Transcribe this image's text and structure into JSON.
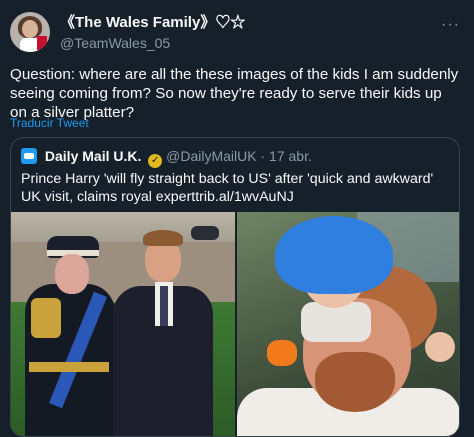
{
  "tweet": {
    "author": {
      "display_name": "《The Wales Family》♡☆",
      "handle": "@TeamWales_05"
    },
    "more_icon": "more-icon",
    "text": "Question: where are all the these images of the kids I am suddenly seeing coming from? So now they're ready to serve their kids up on a silver platter?",
    "translate_label": "Traducir Tweet"
  },
  "quoted_tweet": {
    "name": "Daily Mail U.K.",
    "verified_icon": "verified-badge-icon",
    "handle": "@DailyMailUK",
    "separator": "·",
    "date": "17 abr.",
    "text": "Prince Harry 'will fly straight back to US' after 'quick and awkward' UK visit, claims royal experttrib.al/1wvAuNJ"
  },
  "colors": {
    "background": "#15202b",
    "text": "#f7f9f9",
    "muted": "#8b98a5",
    "link": "#1d9bf0",
    "border": "#38444d",
    "verified_gold": "#e2b719"
  }
}
